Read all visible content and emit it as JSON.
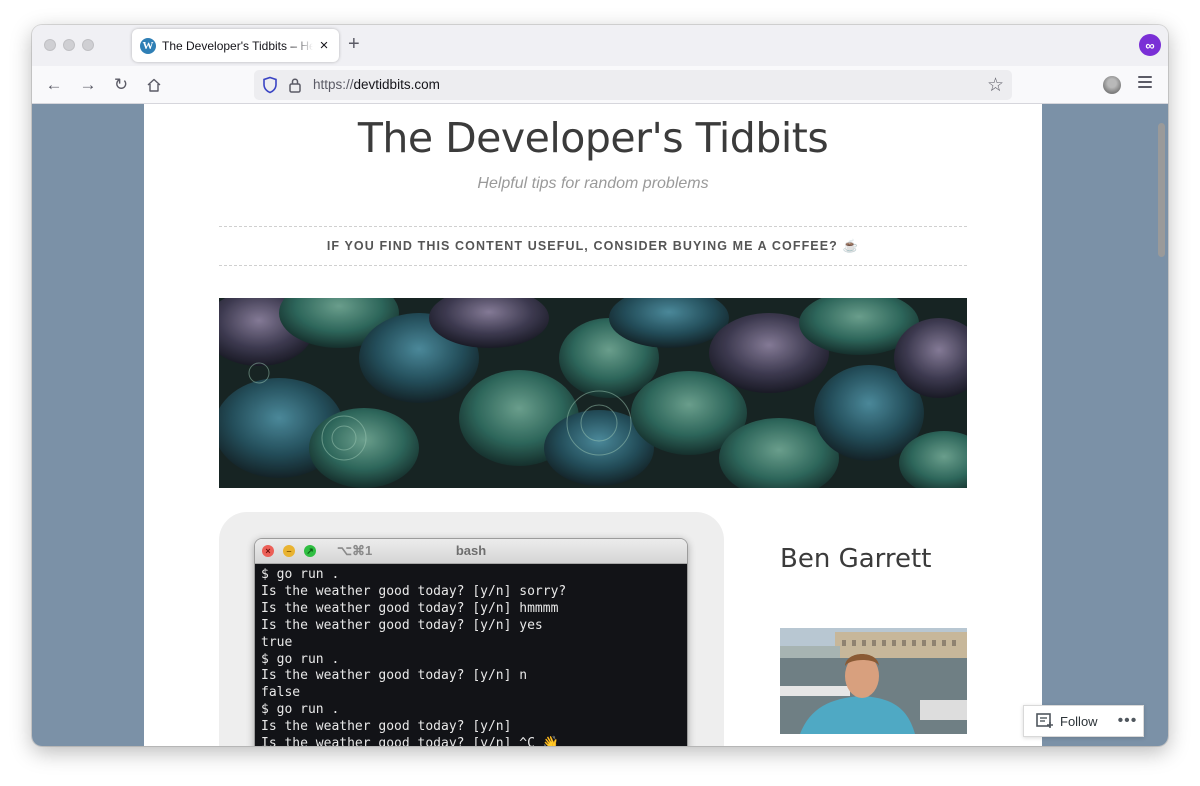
{
  "browser": {
    "tab": {
      "title": "The Developer's Tidbits – Helpful tips for random problems",
      "favicon": "wordpress-icon"
    },
    "url": {
      "scheme": "https://",
      "host": "devtidbits.com"
    },
    "extension_icon": "infinity-icon"
  },
  "site": {
    "title": "The Developer's Tidbits",
    "tagline": "Helpful tips for random problems",
    "coffee_link": "IF YOU FIND THIS CONTENT USEFUL, CONSIDER BUYING ME A COFFEE? ☕"
  },
  "terminal": {
    "shortcut": "⌥⌘1",
    "title": "bash",
    "lines": "$ go run .\nIs the weather good today? [y/n] sorry?\nIs the weather good today? [y/n] hmmmm\nIs the weather good today? [y/n] yes\ntrue\n$ go run .\nIs the weather good today? [y/n] n\nfalse\n$ go run .\nIs the weather good today? [y/n]\nIs the weather good today? [y/n] ^C 👋"
  },
  "sidebar": {
    "author_name": "Ben Garrett"
  },
  "follow": {
    "label": "Follow",
    "more": "•••"
  },
  "colors": {
    "page_bg": "#7b91a7",
    "title_text": "#3b3b3b",
    "terminal_bg": "#121317"
  }
}
